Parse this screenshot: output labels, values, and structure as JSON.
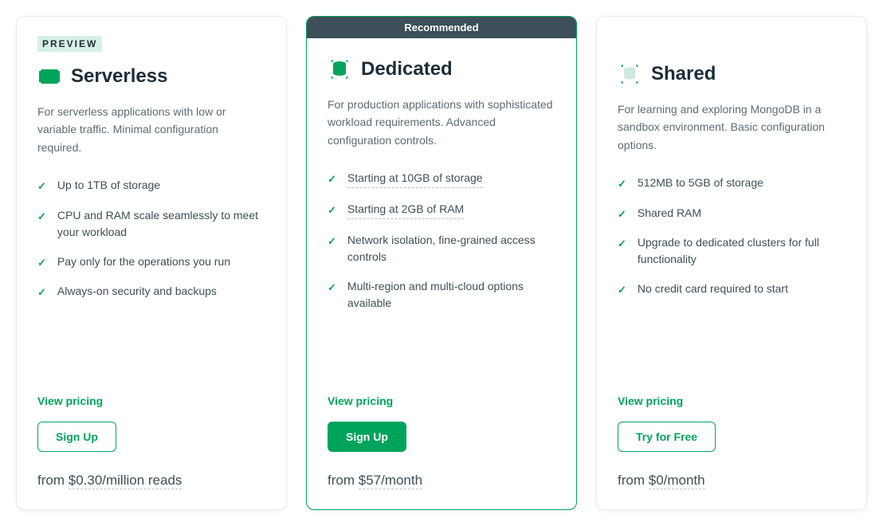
{
  "plans": [
    {
      "badge": "PREVIEW",
      "title": "Serverless",
      "desc": "For serverless applications with low or variable traffic. Minimal configuration required.",
      "features": [
        {
          "text": "Up to 1TB of storage",
          "dotted": false
        },
        {
          "text": "CPU and RAM scale seamlessly to meet your workload",
          "dotted": false
        },
        {
          "text": "Pay only for the operations you run",
          "dotted": false
        },
        {
          "text": "Always-on security and backups",
          "dotted": false
        }
      ],
      "pricing_link": "View pricing",
      "button": "Sign Up",
      "button_style": "outline",
      "price_from": "from ",
      "price_amount": "$0.30/million reads"
    },
    {
      "ribbon": "Recommended",
      "title": "Dedicated",
      "desc": "For production applications with sophisticated workload requirements. Advanced configuration controls.",
      "features": [
        {
          "text": "Starting at 10GB of storage",
          "dotted": true
        },
        {
          "text": "Starting at 2GB of RAM",
          "dotted": true
        },
        {
          "text": "Network isolation, fine-grained access controls",
          "dotted": false
        },
        {
          "text": "Multi-region and multi-cloud options available",
          "dotted": false
        }
      ],
      "pricing_link": "View pricing",
      "button": "Sign Up",
      "button_style": "solid",
      "price_from": "from ",
      "price_amount": "$57/month"
    },
    {
      "title": "Shared",
      "desc": "For learning and exploring MongoDB in a sandbox environment. Basic configuration options.",
      "features": [
        {
          "text": "512MB to 5GB of storage",
          "dotted": false
        },
        {
          "text": "Shared RAM",
          "dotted": false
        },
        {
          "text": "Upgrade to dedicated clusters for full functionality",
          "dotted": false
        },
        {
          "text": "No credit card required to start",
          "dotted": false
        }
      ],
      "pricing_link": "View pricing",
      "button": "Try for Free",
      "button_style": "outline",
      "price_from": "from ",
      "price_amount": "$0/month"
    }
  ]
}
